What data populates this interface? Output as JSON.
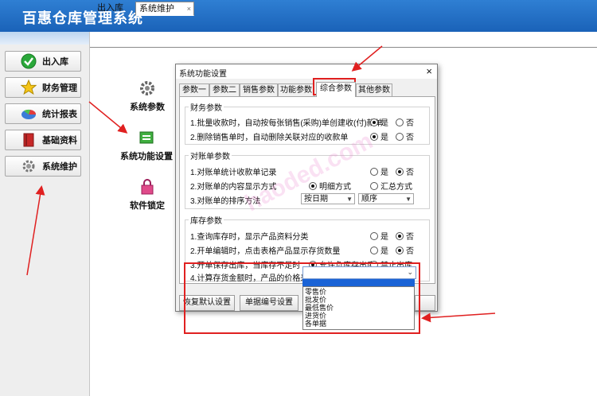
{
  "app": {
    "title": "百惠仓库管理系统"
  },
  "sidebar": {
    "items": [
      {
        "label": "出入库",
        "icon": "check-circle-icon"
      },
      {
        "label": "财务管理",
        "icon": "star-icon"
      },
      {
        "label": "统计报表",
        "icon": "pie-chart-icon"
      },
      {
        "label": "基础资料",
        "icon": "book-icon"
      },
      {
        "label": "系统维护",
        "icon": "gear-icon"
      }
    ]
  },
  "tabs": [
    {
      "label": "出入库",
      "active": false
    },
    {
      "label": "系统维护",
      "active": true,
      "close": "×"
    }
  ],
  "desktop": [
    {
      "label": "系统参数",
      "icon": "gears-icon"
    },
    {
      "label": "系统功能设置",
      "icon": "function-settings-icon"
    },
    {
      "label": "软件锁定",
      "icon": "lock-icon"
    }
  ],
  "dialog": {
    "title": "系统功能设置",
    "close": "×",
    "tabs": [
      "参数一",
      "参数二",
      "销售参数",
      "功能参数",
      "综合参数",
      "其他参数"
    ],
    "active_tab": "综合参数",
    "groups": [
      {
        "title": "财务参数",
        "rows": [
          {
            "text": "1.批量收款时，自动按每张销售(采购)单创建收(付)款单",
            "options": [
              "是",
              "否"
            ],
            "selected": "是"
          },
          {
            "text": "2.删除销售单时，自动删除关联对应的收款单",
            "options": [
              "是",
              "否"
            ],
            "selected": "是"
          }
        ]
      },
      {
        "title": "对账单参数",
        "rows": [
          {
            "text": "1.对账单统计收款单记录",
            "options": [
              "是",
              "否"
            ],
            "selected": "否"
          },
          {
            "text": "2.对账单的内容显示方式",
            "options": [
              "明细方式",
              "汇总方式"
            ],
            "selected": "明细方式"
          },
          {
            "text": "3.对账单的排序方法",
            "selects": [
              "按日期",
              "顺序"
            ]
          }
        ]
      },
      {
        "title": "库存参数",
        "rows": [
          {
            "text": "1.查询库存时，显示产品资料分类",
            "options": [
              "是",
              "否"
            ],
            "selected": "否"
          },
          {
            "text": "2.开单编辑时，点击表格产品显示存货数量",
            "options": [
              "是",
              "否"
            ],
            "selected": "否"
          },
          {
            "text": "3.开单保存出库，当库存不足时",
            "options": [
              "允许负库存出库",
              "禁止出库"
            ],
            "selected": "允许负库存出库"
          },
          {
            "text": "4.计算存货金额时，产品的价格来源",
            "select_value": ""
          }
        ]
      }
    ],
    "buttons": [
      "恢复默认设置",
      "单据编号设置"
    ],
    "dropdown": {
      "options": [
        "零售价",
        "批发价",
        "最低售价",
        "进货价",
        "各单据"
      ]
    }
  },
  "watermark": "haoded.com",
  "colors": {
    "header": "#1f6bc2",
    "annotation": "#e02020",
    "selected": "#1a63d6"
  }
}
